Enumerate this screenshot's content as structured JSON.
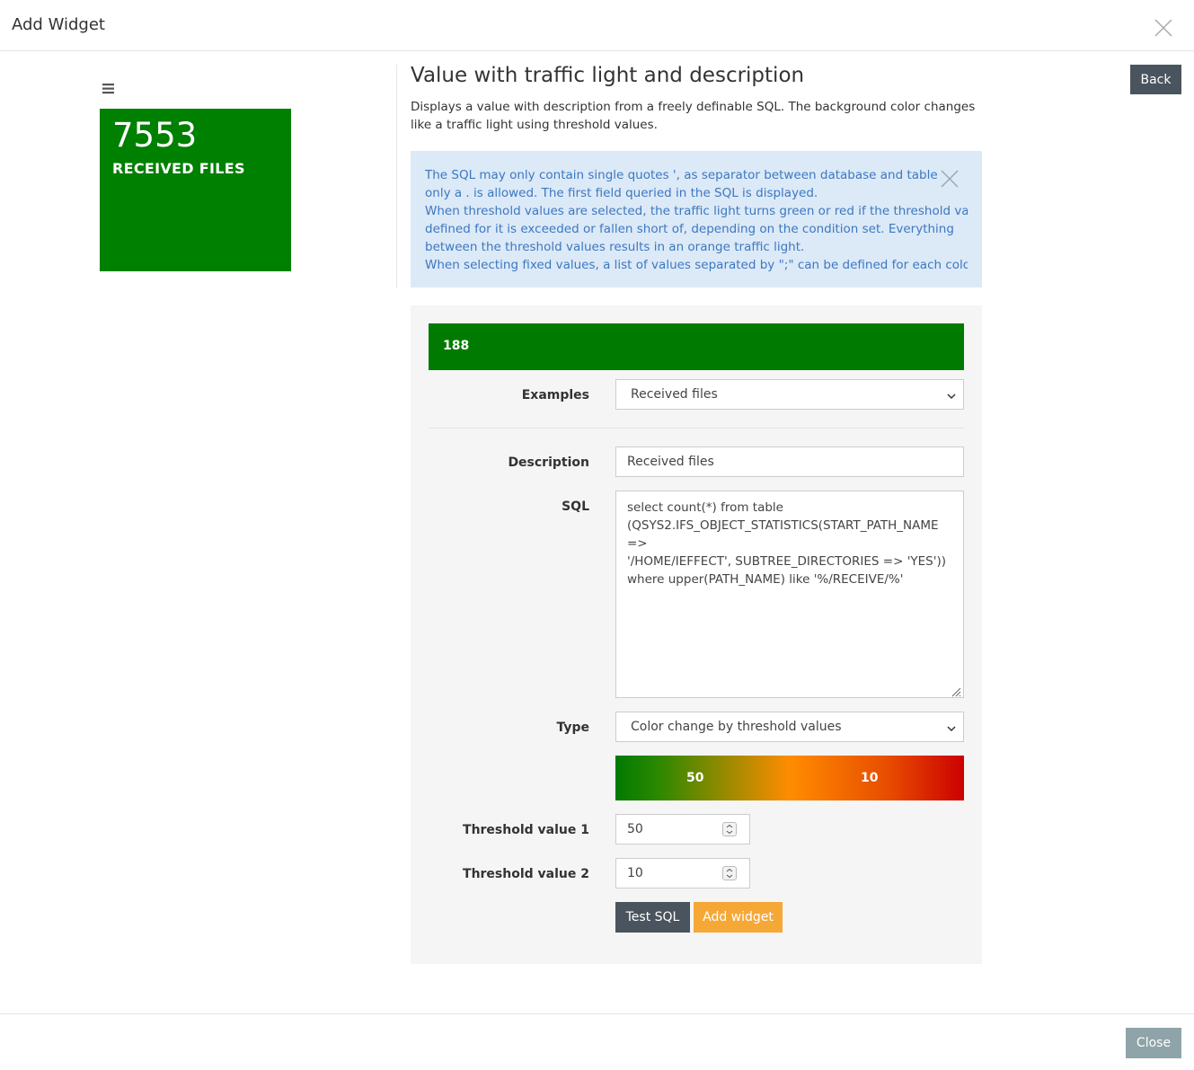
{
  "modal": {
    "title": "Add Widget",
    "close_icon": "close-icon"
  },
  "preview": {
    "menu_icon": "hamburger-menu-icon",
    "value": "7553",
    "description": "RECEIVED FILES",
    "color": "#008000"
  },
  "widget": {
    "title": "Value with traffic light and description",
    "description": "Displays a value with description from a freely definable SQL. The background color changes like a traffic light using threshold values.",
    "back_label": "Back"
  },
  "info": {
    "lines": [
      "The SQL may only contain single quotes ', as separator between database and table",
      "only a . is allowed. The first field queried in the SQL is displayed.",
      "When threshold values are selected, the traffic light turns green or red if the threshold value",
      "defined for it is exceeded or fallen short of, depending on the condition set. Everything",
      "between the threshold values results in an orange traffic light.",
      "When selecting fixed values, a list of values separated by \";\" can be defined for each color"
    ],
    "close_icon": "close-icon"
  },
  "form": {
    "preview_value": "188",
    "examples_label": "Examples",
    "examples_value": "Received files",
    "description_label": "Description",
    "description_value": "Received files",
    "sql_label": "SQL",
    "sql_value": "select count(*) from table\n(QSYS2.IFS_OBJECT_STATISTICS(START_PATH_NAME =>\n'/HOME/IEFFECT', SUBTREE_DIRECTORIES => 'YES'))\nwhere upper(PATH_NAME) like '%/RECEIVE/%'",
    "type_label": "Type",
    "type_value": "Color change by threshold values",
    "gradient_low_label": "50",
    "gradient_high_label": "10",
    "threshold1_label": "Threshold value 1",
    "threshold1_value": "50",
    "threshold2_label": "Threshold value 2",
    "threshold2_value": "10",
    "test_sql_label": "Test SQL",
    "add_widget_label": "Add widget"
  },
  "footer": {
    "close_label": "Close"
  },
  "colors": {
    "green": "#008000",
    "orange": "#ff8c00",
    "red": "#cc0000",
    "info_bg": "#dce9f7",
    "info_text": "#3c78c0",
    "dark_button": "#4a545e",
    "accent_button": "#f6a837"
  }
}
